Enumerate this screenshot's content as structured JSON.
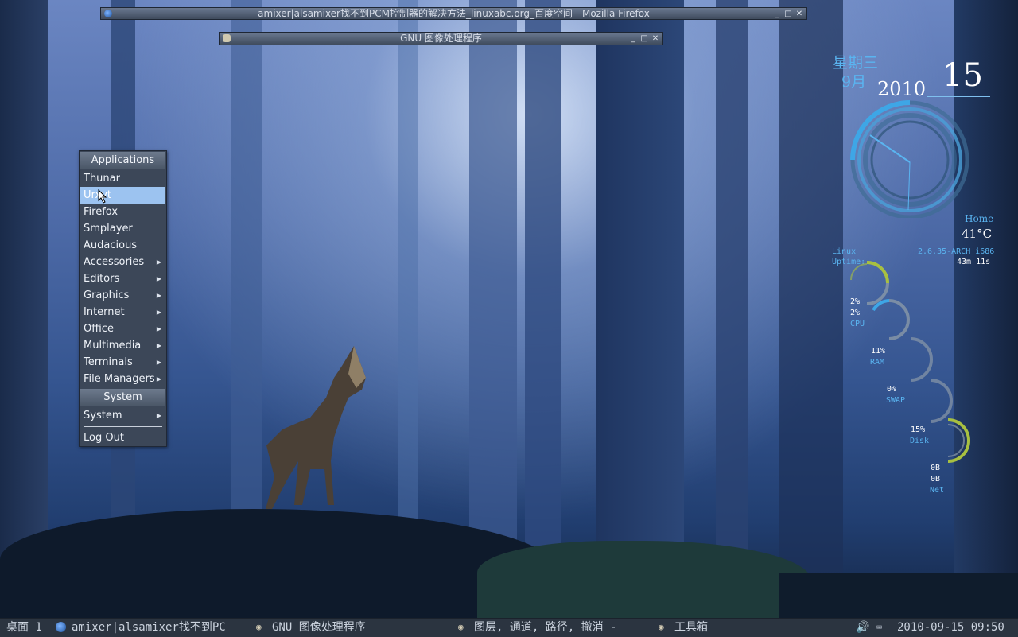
{
  "windows": {
    "firefox_title": "amixer|alsamixer找不到PCM控制器的解决方法_linuxabc.org_百度空间 - Mozilla Firefox",
    "gimp_title": "GNU 图像处理程序"
  },
  "menu": {
    "applications_header": "Applications",
    "items": [
      "Thunar",
      "Urxvt",
      "Firefox",
      "Smplayer",
      "Audacious"
    ],
    "submenus": [
      "Accessories",
      "Editors",
      "Graphics",
      "Internet",
      "Office",
      "Multimedia",
      "Terminals",
      "File Managers"
    ],
    "system_header": "System",
    "system_item": "System",
    "logout": "Log Out",
    "selected": "Urxvt"
  },
  "conky": {
    "weekday": "星期三",
    "month": "9月",
    "year": "2010",
    "day": "15",
    "location": "Home",
    "temperature": "41°C",
    "os": "Linux",
    "kernel": "2.6.35-ARCH i686",
    "uptime_label": "Uptime:",
    "uptime_value": "43m 11s",
    "cpu1": "2%",
    "cpu2": "2%",
    "cpu_label": "CPU",
    "ram_value": "11%",
    "ram_label": "RAM",
    "swap_value": "0%",
    "swap_label": "SWAP",
    "disk_value": "15%",
    "disk_label": "Disk",
    "net_down": "0B",
    "net_up": "0B",
    "net_label": "Net",
    "gauge_percent": {
      "cpu": 2,
      "ram": 11,
      "swap": 0,
      "disk": 15
    },
    "colors": {
      "accent": "#3ea6e6",
      "gauge_yellow": "#a8c040",
      "gauge_track": "#8a98a8"
    }
  },
  "taskbar": {
    "desktop_label": "桌面 1",
    "task_firefox": "amixer|alsamixer找不到PC",
    "task_gimp": "GNU 图像处理程序",
    "task_layers": "图层, 通道, 路径, 撤消 -",
    "task_toolbox": "工具箱",
    "clock": "2010-09-15 09:50"
  }
}
